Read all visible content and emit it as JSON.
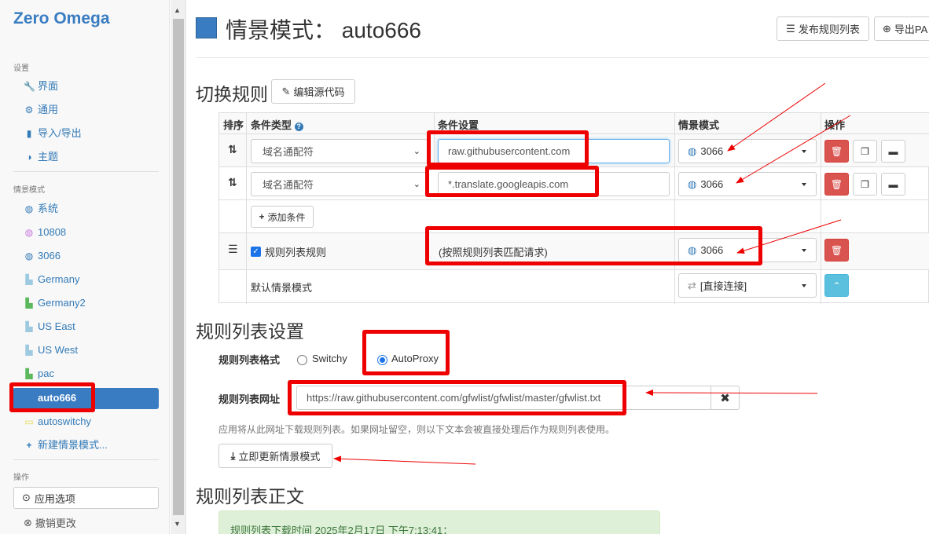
{
  "sidebar": {
    "brand": "Zero Omega",
    "settings_heading": "设置",
    "settings_items": [
      {
        "icon": "wrench-icon",
        "glyph": "🔧",
        "label": "界面"
      },
      {
        "icon": "gear-icon",
        "glyph": "⚙",
        "label": "通用"
      },
      {
        "icon": "floppy-icon",
        "glyph": "▮",
        "label": "导入/导出"
      },
      {
        "icon": "contrast-icon",
        "glyph": "◑",
        "label": "主题"
      }
    ],
    "profiles_heading": "情景模式",
    "profiles": [
      {
        "icon": "globe-icon",
        "glyph": "◍",
        "color": "#337ab7",
        "label": "系统"
      },
      {
        "icon": "globe-icon",
        "glyph": "◍",
        "color": "#c678dd",
        "label": "10808"
      },
      {
        "icon": "globe-icon",
        "glyph": "◍",
        "color": "#337ab7",
        "label": "3066"
      },
      {
        "icon": "file-icon",
        "glyph": "▙",
        "color": "#9ecae1",
        "label": "Germany"
      },
      {
        "icon": "file-icon",
        "glyph": "▙",
        "color": "#5cb85c",
        "label": "Germany2"
      },
      {
        "icon": "file-icon",
        "glyph": "▙",
        "color": "#9ecae1",
        "label": "US East"
      },
      {
        "icon": "file-icon",
        "glyph": "▙",
        "color": "#9ecae1",
        "label": "US West"
      },
      {
        "icon": "file-icon",
        "glyph": "▙",
        "color": "#5cb85c",
        "label": "pac"
      },
      {
        "icon": "list-icon",
        "glyph": "☰",
        "color": "#3a7cc1",
        "label": "auto666"
      },
      {
        "icon": "folder-icon",
        "glyph": "▭",
        "color": "#f0e442",
        "label": "autoswitchy"
      },
      {
        "icon": "plus-icon",
        "glyph": "+",
        "color": "#337ab7",
        "label": "新建情景模式..."
      }
    ],
    "actions_heading": "操作",
    "apply_label": "应用选项",
    "discard_label": "撤销更改"
  },
  "header": {
    "title": "情景模式：  auto666",
    "publish_label": "发布规则列表",
    "export_label": "导出PA"
  },
  "switch_rules": {
    "title": "切换规则",
    "edit_source_label": "编辑源代码",
    "columns": {
      "sort": "排序",
      "cond_type": "条件类型",
      "cond_setting": "条件设置",
      "profile": "情景模式",
      "action": "操作"
    },
    "rows": [
      {
        "cond_type": "域名通配符",
        "cond_value": "raw.githubusercontent.com",
        "profile": "3066"
      },
      {
        "cond_type": "域名通配符",
        "cond_value": "*.translate.googleapis.com",
        "profile": "3066"
      }
    ],
    "add_condition_label": "添加条件",
    "rule_list_label": "规则列表规则",
    "rule_list_desc": "(按照规则列表匹配请求)",
    "rule_list_profile": "3066",
    "default_label": "默认情景模式",
    "default_profile": "[直接连接]"
  },
  "rule_list_settings": {
    "title": "规则列表设置",
    "format_label": "规则列表格式",
    "format_options": [
      "Switchy",
      "AutoProxy"
    ],
    "format_selected": "AutoProxy",
    "url_label": "规则列表网址",
    "url_value": "https://raw.githubusercontent.com/gfwlist/gfwlist/master/gfwlist.txt",
    "help_text": "应用将从此网址下载规则列表。如果网址留空，则以下文本会被直接处理后作为规则列表使用。",
    "update_label": "立即更新情景模式"
  },
  "rule_list_text": {
    "title": "规则列表正文",
    "download_time": "规则列表下载时间 2025年2月17日 下午7:13:41："
  },
  "annotation_color": "#ee0000"
}
